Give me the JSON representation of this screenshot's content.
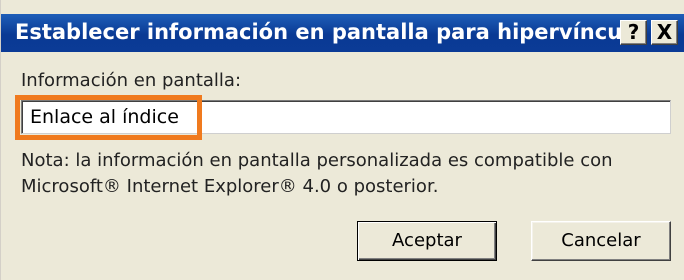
{
  "dialog": {
    "title": "Establecer información en pantalla para hipervínculo",
    "help_label": "?",
    "close_label": "X",
    "field_label": "Información en pantalla:",
    "field_value": "Enlace al índice",
    "note": "Nota: la información en pantalla personalizada es compatible con Microsoft® Internet Explorer® 4.0 o posterior.",
    "ok_label": "Aceptar",
    "cancel_label": "Cancelar"
  },
  "colors": {
    "titlebar": "#0a3a94",
    "dialog_bg": "#ece9d8",
    "highlight": "#f07a1e"
  }
}
